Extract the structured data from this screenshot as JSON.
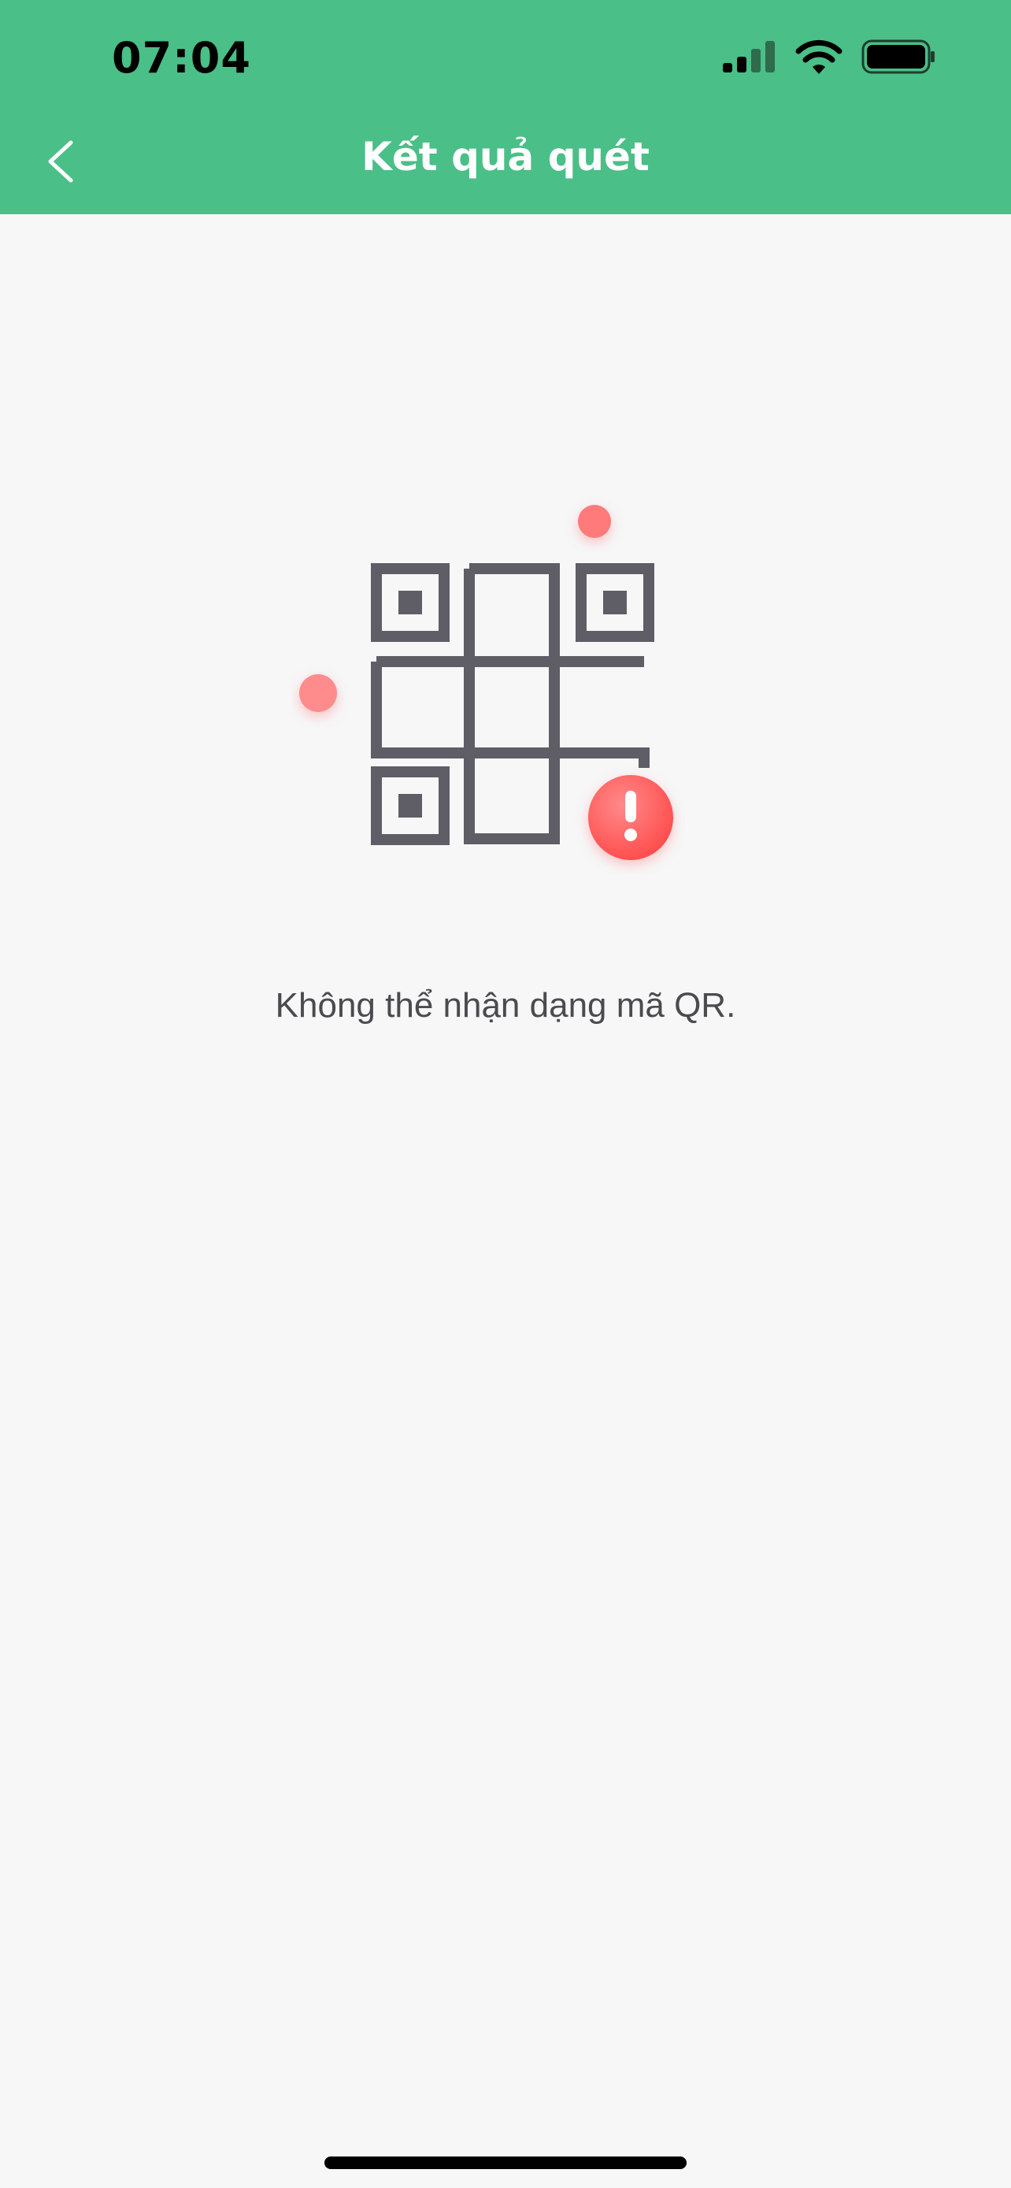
{
  "status_bar": {
    "time": "07:04",
    "signal_icon": "cellular-signal-icon",
    "wifi_icon": "wifi-icon",
    "battery_icon": "battery-icon"
  },
  "nav": {
    "title": "Kết quả quét",
    "back_icon": "chevron-left-icon"
  },
  "result": {
    "illustration": "qr-code-error-illustration",
    "message": "Không thể nhận dạng mã QR."
  },
  "colors": {
    "header": "#4abf87",
    "background": "#f7f7f8",
    "qr_stroke": "#5f5e66",
    "error_red": "#ff5f5f",
    "dot_red": "#ff8c8c"
  }
}
